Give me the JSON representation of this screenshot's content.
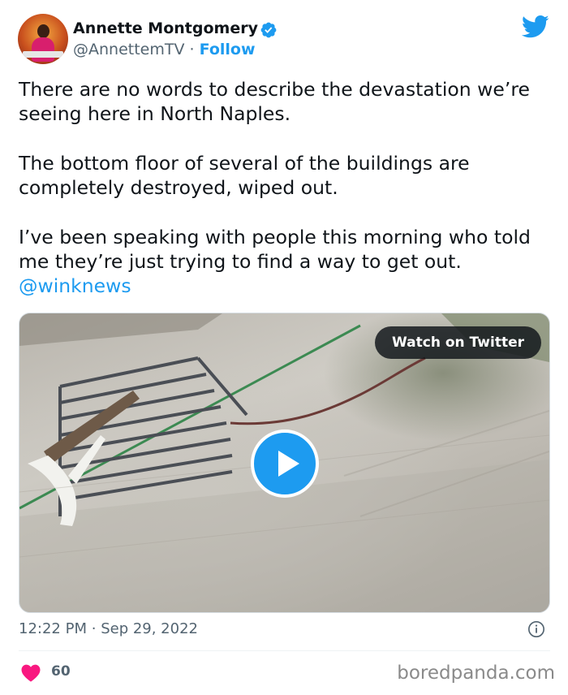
{
  "author": {
    "display_name": "Annette Montgomery",
    "handle": "@AnnettemTV",
    "separator": "·",
    "follow_label": "Follow"
  },
  "tweet": {
    "paragraphs": [
      "There are no words to describe the devastation we’re seeing here in North Naples.",
      "The bottom floor of several of the buildings are completely destroyed, wiped out.",
      "I’ve been speaking with people this morning who told me they’re just trying to find a way to get out."
    ],
    "mention": "@winknews"
  },
  "media": {
    "watch_label": "Watch on Twitter"
  },
  "meta": {
    "time": "12:22 PM",
    "date_separator": "·",
    "date": "Sep 29, 2022",
    "like_count": "60"
  },
  "watermark": "boredpanda.com",
  "colors": {
    "accent": "#1d9bf0",
    "heart": "#f91880",
    "secondary_text": "#536471"
  },
  "icons": [
    "verified-badge-icon",
    "twitter-bird-icon",
    "play-icon",
    "info-icon",
    "heart-icon"
  ]
}
